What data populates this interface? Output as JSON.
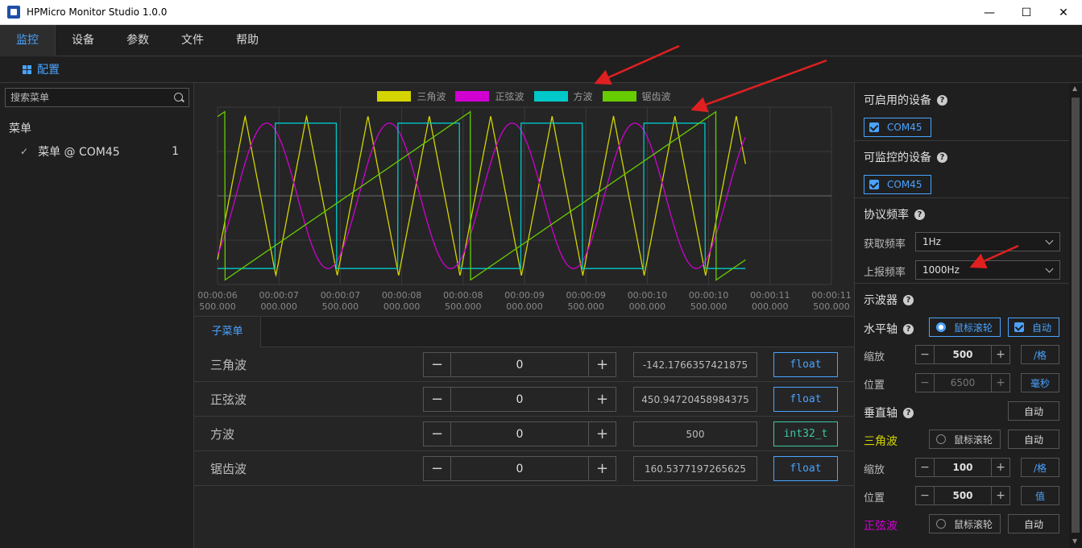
{
  "window": {
    "title": "HPMicro Monitor Studio 1.0.0",
    "min_glyph": "—",
    "max_glyph": "☐",
    "close_glyph": "✕"
  },
  "menu": {
    "items": [
      "监控",
      "设备",
      "参数",
      "文件",
      "帮助"
    ],
    "active": "监控"
  },
  "toolbar": {
    "config_label": "配置"
  },
  "sidebar": {
    "search_placeholder": "搜索菜单",
    "root_label": "菜单",
    "items": [
      {
        "label": "菜单 @ COM45",
        "count": "1"
      }
    ]
  },
  "chart_data": {
    "type": "line",
    "series": [
      {
        "name": "三角波",
        "color": "#d4d400",
        "kind": "triangle"
      },
      {
        "name": "正弦波",
        "color": "#d000d0",
        "kind": "sine"
      },
      {
        "name": "方波",
        "color": "#00c8c8",
        "kind": "square"
      },
      {
        "name": "锯齿波",
        "color": "#66cc00",
        "kind": "sawtooth"
      }
    ],
    "x_ticks": [
      [
        "00:00:06",
        "500.000"
      ],
      [
        "00:00:07",
        "000.000"
      ],
      [
        "00:00:07",
        "500.000"
      ],
      [
        "00:00:08",
        "000.000"
      ],
      [
        "00:00:08",
        "500.000"
      ],
      [
        "00:00:09",
        "000.000"
      ],
      [
        "00:00:09",
        "500.000"
      ],
      [
        "00:00:10",
        "000.000"
      ],
      [
        "00:00:10",
        "500.000"
      ],
      [
        "00:00:11",
        "000.000"
      ],
      [
        "00:00:11",
        "500.000"
      ]
    ],
    "grid": true
  },
  "submenu": {
    "tab_label": "子菜单",
    "rows": [
      {
        "label": "三角波",
        "step_value": "0",
        "value": "-142.1766357421875",
        "type": "float"
      },
      {
        "label": "正弦波",
        "step_value": "0",
        "value": "450.94720458984375",
        "type": "float"
      },
      {
        "label": "方波",
        "step_value": "0",
        "value": "500",
        "type": "int32_t"
      },
      {
        "label": "锯齿波",
        "step_value": "0",
        "value": "160.5377197265625",
        "type": "float"
      }
    ]
  },
  "right": {
    "enabled_devices_title": "可启用的设备",
    "enabled_device": "COM45",
    "monitor_devices_title": "可监控的设备",
    "monitor_device": "COM45",
    "protocol_title": "协议频率",
    "fetch_label": "获取频率",
    "fetch_value": "1Hz",
    "report_label": "上报频率",
    "report_value": "1000Hz",
    "scope_title": "示波器",
    "h_axis": "水平轴",
    "mouse_wheel": "鼠标滚轮",
    "auto": "自动",
    "zoom": "缩放",
    "position": "位置",
    "h_zoom_value": "500",
    "h_zoom_unit": "/格",
    "h_pos_value": "6500",
    "h_pos_unit": "毫秒",
    "v_axis": "垂直轴",
    "tri_label": "三角波",
    "tri_zoom_value": "100",
    "tri_zoom_unit": "/格",
    "tri_pos_value": "500",
    "tri_pos_unit": "值",
    "sine_label": "正弦波"
  }
}
